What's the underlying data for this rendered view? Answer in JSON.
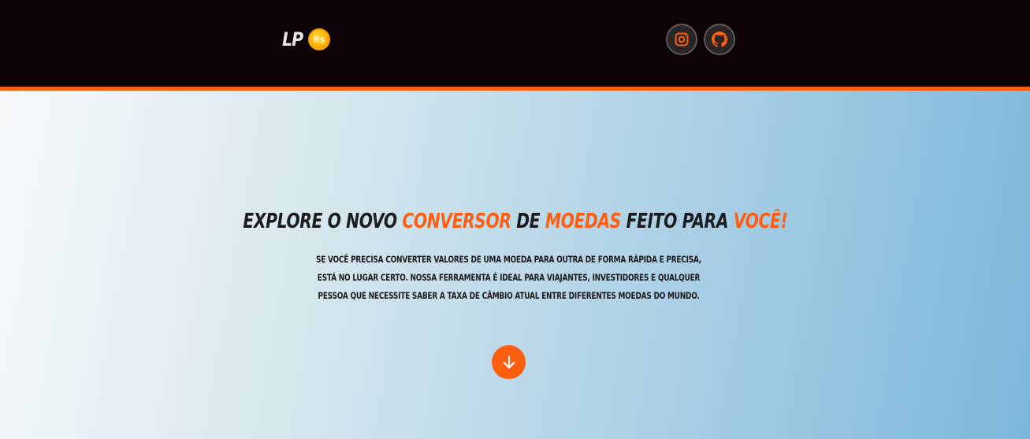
{
  "header": {
    "logo_text": "LP",
    "coin_text": "R$",
    "social": [
      {
        "name": "instagram",
        "icon": "instagram-icon"
      },
      {
        "name": "github",
        "icon": "github-icon"
      }
    ]
  },
  "hero": {
    "headline": {
      "part1": "Explore o novo ",
      "highlight1": "conversor",
      "part2": " de ",
      "highlight2": "moedas",
      "part3": " feito para ",
      "highlight3": "você!"
    },
    "description": "Se você precisa converter valores de uma moeda para outra de forma rápida e precisa, está no lugar certo. Nossa ferramenta é ideal para viajantes, investidores e qualquer pessoa que necessite saber a taxa de câmbio atual entre diferentes moedas do mundo.",
    "scroll_icon": "arrow-down-icon"
  },
  "colors": {
    "header_bg": "#0f0108",
    "accent": "#ff5e10",
    "text_dark": "#1c1b1d",
    "coin": "#ffb300"
  }
}
